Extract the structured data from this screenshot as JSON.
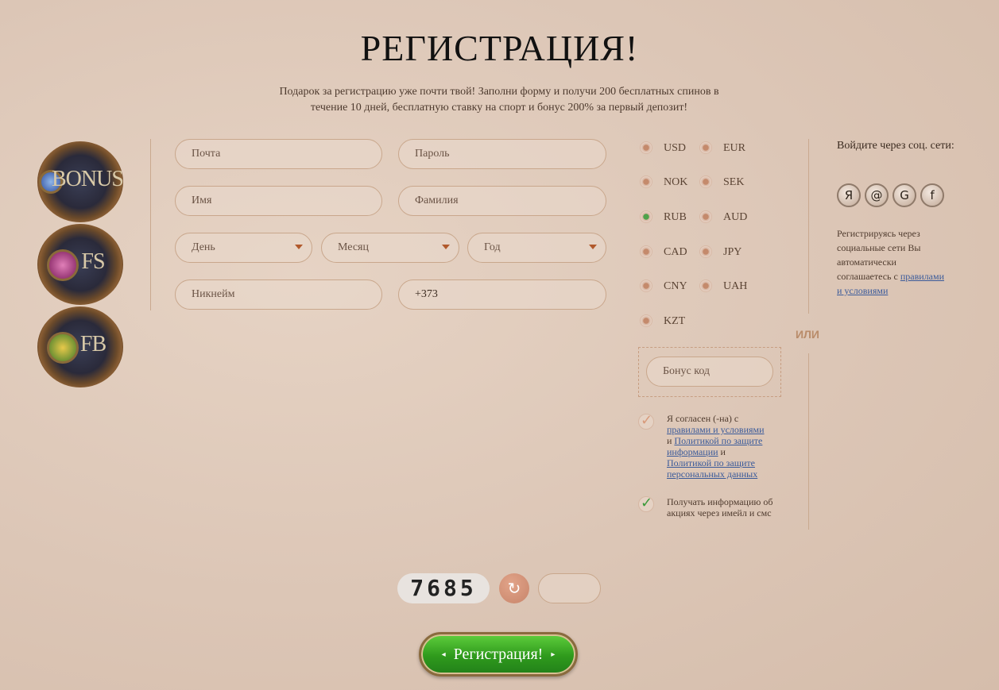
{
  "page": {
    "title": "РЕГИСТРАЦИЯ!",
    "subtitle": "Подарок за регистрацию уже почти твой! Заполни форму и получи 200 бесплатных спинов в течение 10 дней, бесплатную ставку на спорт и бонус 200% за первый депозит!"
  },
  "bonuses": [
    {
      "label": "BONUS",
      "icon": "bonus-badge-icon"
    },
    {
      "label": "FS",
      "icon": "free-spins-badge-icon"
    },
    {
      "label": "FB",
      "icon": "free-bet-badge-icon"
    }
  ],
  "form": {
    "email_placeholder": "Почта",
    "password_placeholder": "Пароль",
    "first_name_placeholder": "Имя",
    "last_name_placeholder": "Фамилия",
    "day_label": "День",
    "month_label": "Месяц",
    "year_label": "Год",
    "nickname_placeholder": "Никнейм",
    "phone_value": "+373"
  },
  "currencies": [
    {
      "code": "USD",
      "selected": false
    },
    {
      "code": "EUR",
      "selected": false
    },
    {
      "code": "NOK",
      "selected": false
    },
    {
      "code": "SEK",
      "selected": false
    },
    {
      "code": "RUB",
      "selected": true
    },
    {
      "code": "AUD",
      "selected": false
    },
    {
      "code": "CAD",
      "selected": false
    },
    {
      "code": "JPY",
      "selected": false
    },
    {
      "code": "CNY",
      "selected": false
    },
    {
      "code": "UAH",
      "selected": false
    },
    {
      "code": "KZT",
      "selected": false
    }
  ],
  "bonus_code_placeholder": "Бонус код",
  "or_label": "ИЛИ",
  "agree": {
    "prefix": "Я согласен (-на) с",
    "terms_link": "правилами и условиями",
    "and1": "и",
    "privacy_link": "Политикой по защите информации",
    "and2": "и",
    "personal_link": "Политикой по защите персональных данных"
  },
  "news_text": "Получать информацию об акциях через имейл и смс",
  "social": {
    "title": "Войдите через соц. сети:",
    "icons": [
      {
        "name": "yandex-icon",
        "glyph": "Я"
      },
      {
        "name": "mailru-icon",
        "glyph": "@"
      },
      {
        "name": "google-icon",
        "glyph": "G"
      },
      {
        "name": "facebook-icon",
        "glyph": "f"
      }
    ],
    "note": "Регистрируясь через социальные сети Вы автоматически соглашаетесь с",
    "note_link": "правилами и условиями"
  },
  "captcha": {
    "code": "7685",
    "refresh_glyph": "↻",
    "input_value": ""
  },
  "submit_label": "Регистрация!",
  "colors": {
    "accent_green": "#2f9a1c",
    "link_blue": "#3a5a9a",
    "caret": "#b1592c"
  }
}
